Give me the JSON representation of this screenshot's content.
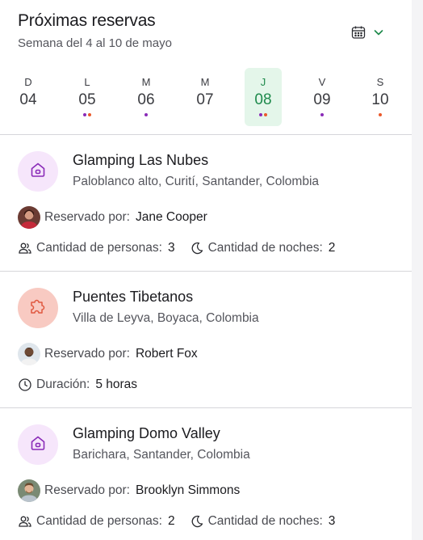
{
  "header": {
    "title": "Próximas reservas",
    "subtitle": "Semana del 4 al 10 de mayo",
    "calendar_icon": "calendar-icon",
    "dropdown_icon": "chevron-down-icon"
  },
  "colors": {
    "accent_green": "#1e8a4c",
    "selected_bg": "#e4f6ea",
    "dot_purple": "#8a2bb8",
    "dot_orange": "#ea5a2c",
    "house_icon_bg": "#f6e6fb",
    "house_icon_color": "#8a2bb8",
    "puzzle_icon_bg": "#f8cac2",
    "puzzle_icon_color": "#e0583f"
  },
  "week": {
    "days": [
      {
        "letter": "D",
        "number": "04",
        "selected": false,
        "dots": []
      },
      {
        "letter": "L",
        "number": "05",
        "selected": false,
        "dots": [
          "#8a2bb8",
          "#ea5a2c"
        ]
      },
      {
        "letter": "M",
        "number": "06",
        "selected": false,
        "dots": [
          "#8a2bb8"
        ]
      },
      {
        "letter": "M",
        "number": "07",
        "selected": false,
        "dots": []
      },
      {
        "letter": "J",
        "number": "08",
        "selected": true,
        "dots": [
          "#8a2bb8",
          "#ea5a2c"
        ]
      },
      {
        "letter": "V",
        "number": "09",
        "selected": false,
        "dots": [
          "#8a2bb8"
        ]
      },
      {
        "letter": "S",
        "number": "10",
        "selected": false,
        "dots": [
          "#ea5a2c"
        ]
      }
    ]
  },
  "reservations": [
    {
      "icon": "house-icon",
      "name": "Glamping Las Nubes",
      "location": "Paloblanco alto, Curití, Santander, Colombia",
      "booked_by_label": "Reservado por:",
      "booked_by": "Jane Cooper",
      "persons_label": "Cantidad de personas:",
      "persons": "3",
      "nights_label": "Cantidad de noches:",
      "nights": "2"
    },
    {
      "icon": "puzzle-icon",
      "name": "Puentes Tibetanos",
      "location": "Villa de Leyva, Boyaca, Colombia",
      "booked_by_label": "Reservado por:",
      "booked_by": "Robert Fox",
      "duration_label": "Duración:",
      "duration": "5 horas"
    },
    {
      "icon": "house-icon",
      "name": "Glamping Domo Valley",
      "location": "Barichara, Santander, Colombia",
      "booked_by_label": "Reservado por:",
      "booked_by": "Brooklyn Simmons",
      "persons_label": "Cantidad de personas:",
      "persons": "2",
      "nights_label": "Cantidad de noches:",
      "nights": "3"
    }
  ]
}
